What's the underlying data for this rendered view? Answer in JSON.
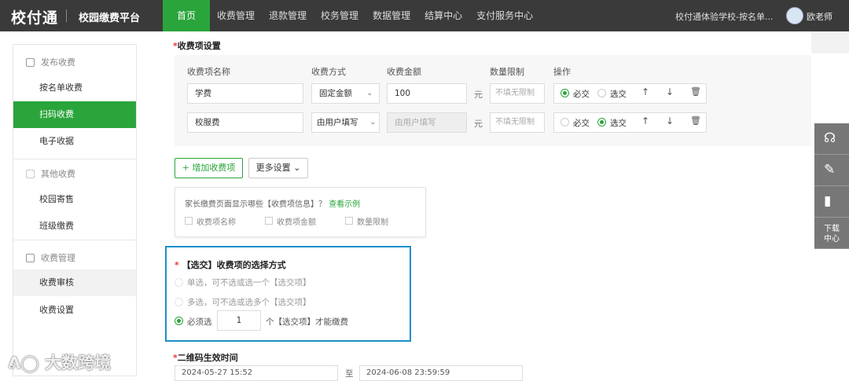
{
  "header": {
    "logo": "校付通",
    "platform": "校园缴费平台",
    "nav": [
      "首页",
      "收费管理",
      "退款管理",
      "校务管理",
      "数据管理",
      "结算中心",
      "支付服务中心"
    ],
    "school": "校付通体验学校-按名单...",
    "user": "欧老师"
  },
  "sidebar": {
    "group1": "发布收费",
    "item1": "按名单收费",
    "item2": "扫码收费",
    "item3": "电子收据",
    "group2": "其他收费",
    "item4": "校园寄售",
    "item5": "班级缴费",
    "group3": "收费管理",
    "item6": "收费审核",
    "item7": "收费设置"
  },
  "fee_settings": {
    "title": "收费项设置",
    "columns": {
      "name": "收费项名称",
      "method": "收费方式",
      "amount": "收费金额",
      "limit": "数量限制",
      "ops": "操作"
    },
    "rows": [
      {
        "name": "学费",
        "method": "固定金额",
        "amount": "100",
        "amount_placeholder": "",
        "unit": "元",
        "limit_placeholder": "不填无限制",
        "required_label": "必交",
        "optional_label": "选交",
        "selected": "required"
      },
      {
        "name": "校服费",
        "method": "由用户填写",
        "amount": "",
        "amount_placeholder": "由用户填写",
        "unit": "元",
        "limit_placeholder": "不填无限制",
        "required_label": "必交",
        "optional_label": "选交",
        "selected": "optional"
      }
    ],
    "icons": [
      "arrow-up-icon",
      "arrow-down-icon",
      "trash-icon"
    ]
  },
  "actions": {
    "add_item": "+ 增加收费项",
    "more_settings": "更多设置"
  },
  "display_settings": {
    "question": "家长缴费页面显示哪些【收费项信息】？",
    "example_link": "查看示例",
    "options": [
      "收费项名称",
      "收费项金额",
      "数量限制"
    ]
  },
  "selection_mode": {
    "title": "【选交】收费项的选择方式",
    "opt1": "单选，可不选或选一个【选交项】",
    "opt2": "多选，可不选或选多个【选交项】",
    "opt3_prefix": "必须选",
    "opt3_value": "1",
    "opt3_suffix": "个【选交项】才能缴费",
    "selected": 3
  },
  "qr_section": {
    "title": "二维码生效时间",
    "start": "2024-05-27 15:52",
    "to": "至",
    "end": "2024-06-08 23:59:59"
  },
  "right_toolbar": {
    "download": "下载\n中心"
  },
  "watermark": "大数跨境",
  "colors": {
    "accent": "#2aa53b",
    "topbar": "#3a3a3a",
    "highlight_border": "#1e90c8"
  }
}
